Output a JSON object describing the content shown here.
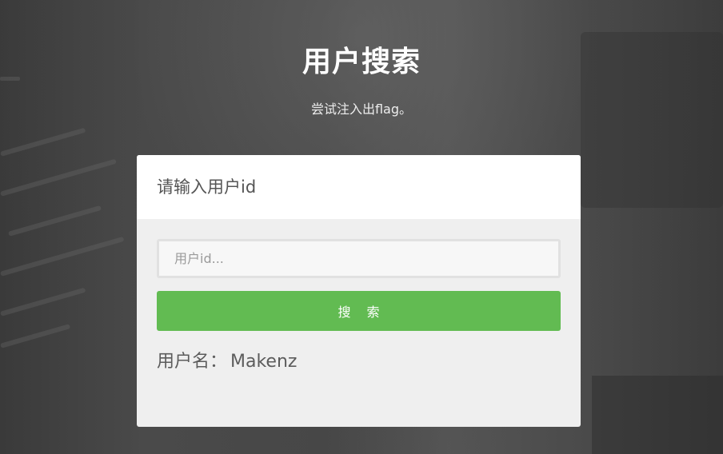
{
  "header": {
    "title": "用户搜索",
    "subtitle": "尝试注入出flag。"
  },
  "panel": {
    "heading": "请输入用户id",
    "search": {
      "placeholder": "用户id...",
      "value": ""
    },
    "button_label": "搜索",
    "result": {
      "label": "用户名：",
      "value": "Makenz"
    }
  },
  "colors": {
    "accent_button": "#62bb52",
    "panel_background": "#efefef",
    "panel_header_background": "#ffffff",
    "page_background": "#3e3e3e"
  }
}
